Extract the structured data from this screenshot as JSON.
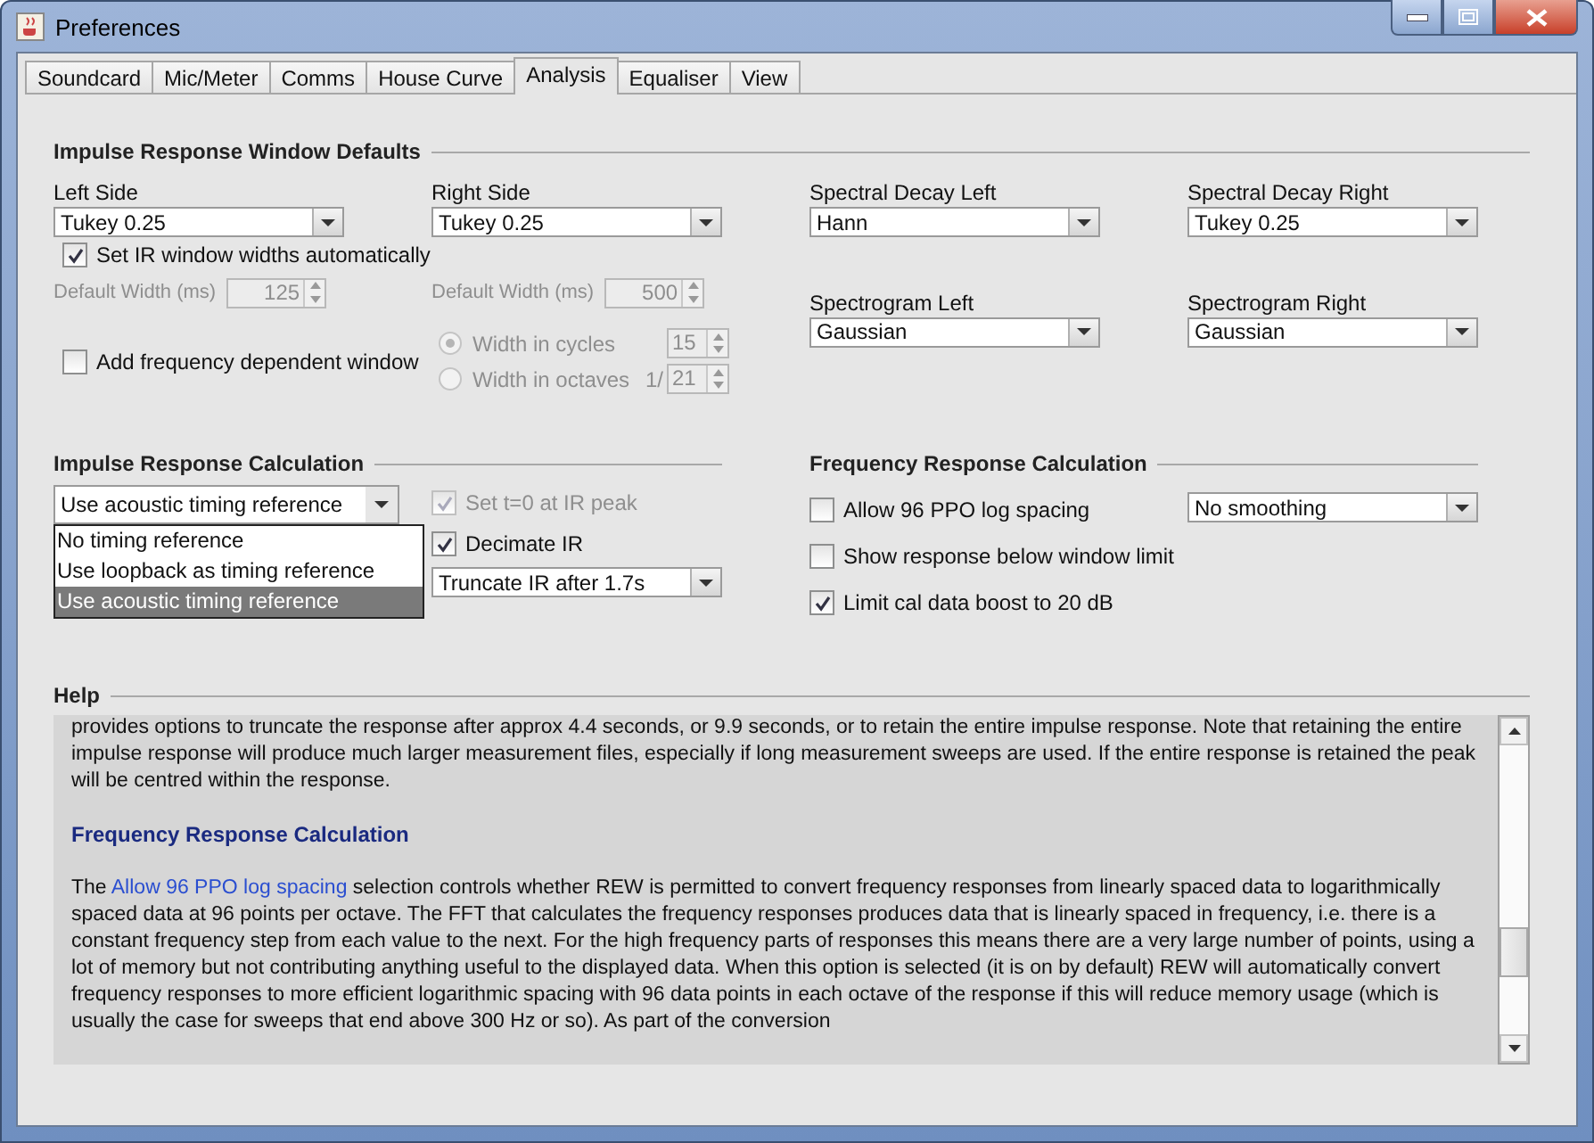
{
  "window": {
    "title": "Preferences"
  },
  "tabs": [
    {
      "label": "Soundcard",
      "selected": false
    },
    {
      "label": "Mic/Meter",
      "selected": false
    },
    {
      "label": "Comms",
      "selected": false
    },
    {
      "label": "House Curve",
      "selected": false
    },
    {
      "label": "Analysis",
      "selected": true
    },
    {
      "label": "Equaliser",
      "selected": false
    },
    {
      "label": "View",
      "selected": false
    }
  ],
  "ir_window_defaults": {
    "title": "Impulse Response Window Defaults",
    "combos": [
      {
        "label": "Left Side",
        "value": "Tukey 0.25"
      },
      {
        "label": "Right Side",
        "value": "Tukey 0.25"
      },
      {
        "label": "Spectral Decay Left",
        "value": "Hann"
      },
      {
        "label": "Spectral Decay Right",
        "value": "Tukey 0.25"
      },
      {
        "label": "Spectrogram Left",
        "value": "Gaussian"
      },
      {
        "label": "Spectrogram Right",
        "value": "Gaussian"
      }
    ],
    "auto_widths": {
      "label": "Set IR window widths automatically",
      "checked": true,
      "disabled": false
    },
    "default_widths": [
      {
        "label": "Default Width (ms)",
        "value": "125",
        "disabled": true
      },
      {
        "label": "Default Width (ms)",
        "value": "500",
        "disabled": true
      }
    ],
    "freq_dependent": {
      "label": "Add frequency dependent window",
      "checked": false,
      "disabled": false
    },
    "width_options": [
      {
        "label": "Width in cycles",
        "value": "15",
        "selected": true,
        "disabled": true
      },
      {
        "label": "Width in octaves",
        "prefix": "1/",
        "value": "21",
        "selected": false,
        "disabled": true
      }
    ]
  },
  "ir_calculation": {
    "title": "Impulse Response Calculation",
    "timing": {
      "value": "Use acoustic timing reference",
      "expanded": true,
      "options": [
        {
          "label": "No timing reference",
          "selected": false
        },
        {
          "label": "Use loopback as timing reference",
          "selected": false
        },
        {
          "label": "Use acoustic timing reference",
          "selected": true
        }
      ]
    },
    "set_t0": {
      "label": "Set t=0 at IR peak",
      "checked": true,
      "disabled": true
    },
    "decimate": {
      "label": "Decimate IR",
      "checked": true,
      "disabled": false
    },
    "truncate": {
      "value": "Truncate IR after 1.7s"
    }
  },
  "fr_calculation": {
    "title": "Frequency Response Calculation",
    "checkboxes": [
      {
        "label": "Allow 96 PPO log spacing",
        "checked": false,
        "disabled": false
      },
      {
        "label": "Show response below window limit",
        "checked": false,
        "disabled": false
      },
      {
        "label": "Limit cal data boost to 20 dB",
        "checked": true,
        "disabled": false
      }
    ],
    "smoothing": {
      "value": "No  smoothing"
    }
  },
  "help": {
    "title": "Help",
    "blocks": [
      {
        "kind": "paragraph",
        "text": "provides options to truncate the response after approx 4.4 seconds, or 9.9 seconds, or to retain the entire impulse response. Note that retaining the entire impulse response will produce much larger measurement files, especially if long measurement sweeps are used. If the entire response is retained the peak will be centred within the response."
      },
      {
        "kind": "heading",
        "text": "Frequency Response Calculation"
      },
      {
        "kind": "linked",
        "before": "The ",
        "link": "Allow 96 PPO log spacing",
        "after": " selection controls whether REW is permitted to convert frequency responses from linearly spaced data to logarithmically spaced data at 96 points per octave. The FFT that calculates the frequency responses produces data that is linearly spaced in frequency, i.e. there is a constant frequency step from each value to the next. For the high frequency parts of responses this means there are a very large number of points, using a lot of memory but not contributing anything useful to the displayed data. When this option is selected (it is on by default) REW will automatically convert frequency responses to more efficient logarithmic spacing with 96 data points in each octave of the response if this will reduce memory usage (which is usually the case for sweeps that end above 300 Hz or so). As part of the conversion"
      }
    ]
  }
}
